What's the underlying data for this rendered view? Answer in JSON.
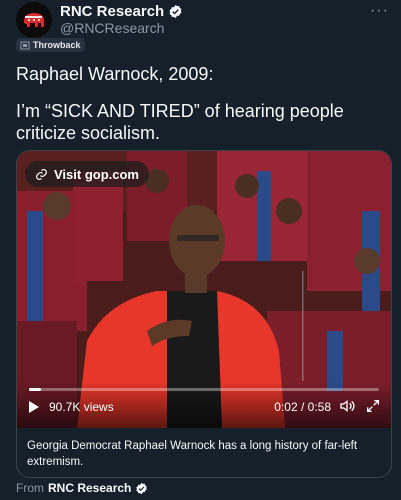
{
  "author": {
    "display_name": "RNC Research",
    "handle": "@RNCResearch"
  },
  "tag": {
    "label": "Throwback"
  },
  "more_label": "···",
  "tweet": {
    "line1": "Raphael Warnock, 2009:",
    "line2": "I’m “SICK AND TIRED” of hearing people criticize socialism."
  },
  "card": {
    "visit_label": "Visit gop.com",
    "views": "90.7K views",
    "time": "0:02 / 0:58",
    "progress": 0.035,
    "caption": "Georgia Democrat Raphael Warnock has a long history of far-left extremism."
  },
  "footer": {
    "from_label": "From",
    "source_name": "RNC Research"
  },
  "colors": {
    "background": "#15202b",
    "verified": "#1d9bf0",
    "muted": "#8b98a5",
    "robe": "#e8362a"
  }
}
